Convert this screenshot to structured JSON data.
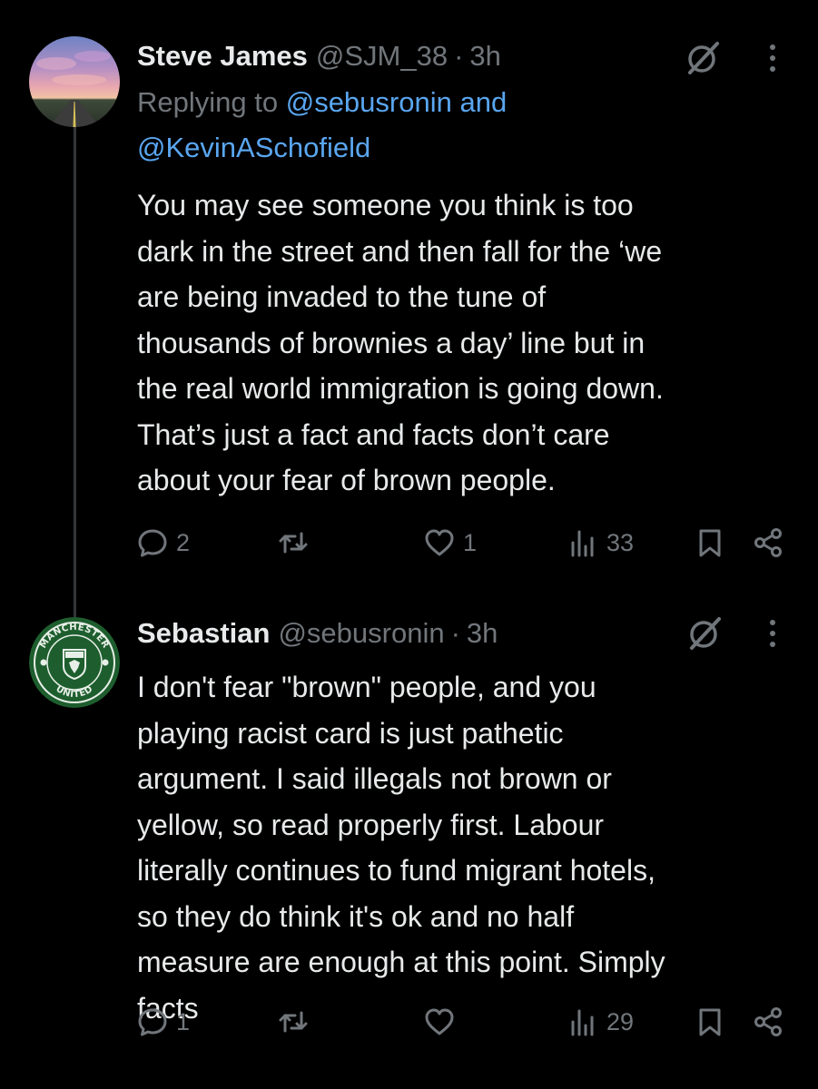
{
  "tweets": [
    {
      "name": "Steve James",
      "handle": "@SJM_38",
      "separator": "·",
      "time": "3h",
      "replying_prefix": "Replying to",
      "replying_mention_1": "@sebusronin",
      "replying_and": "and",
      "replying_mention_2": "@KevinASchofield",
      "text": "You may see someone you think is too\ndark in the street and then fall for the ‘we\nare being invaded to the tune of\nthousands of brownies a day’ line but in\nthe real world immigration is going down.\nThat’s just a fact and facts don’t care\nabout your fear of brown people.",
      "replies": "2",
      "likes": "1",
      "views": "33"
    },
    {
      "name": "Sebastian",
      "handle": "@sebusronin",
      "separator": "·",
      "time": "3h",
      "text": "I don't fear \"brown\" people, and you\nplaying racist card is just pathetic\nargument. I said illegals not brown or\nyellow, so read properly first. Labour\nliterally continues to fund migrant hotels,\nso they do think it's ok and no half\nmeasure are enough at this point. Simply\nfacts",
      "replies": "1",
      "likes": "",
      "views": "29",
      "avatar_badge_top": "MANCHESTER",
      "avatar_badge_bottom": "UNITED"
    }
  ],
  "icons": {
    "reply": "speech-bubble-icon",
    "retweet": "retweet-icon",
    "like": "heart-icon",
    "views": "bar-chart-icon",
    "bookmark": "bookmark-icon",
    "share": "share-icon",
    "grok": "grok-slash-icon",
    "more": "vertical-ellipsis-icon"
  },
  "colors": {
    "background": "#000000",
    "text_primary": "#e7e9ea",
    "text_secondary": "#71767b",
    "mention": "#5aa6f0",
    "thread_line": "#333639",
    "badge_green": "#1e5e2e"
  }
}
